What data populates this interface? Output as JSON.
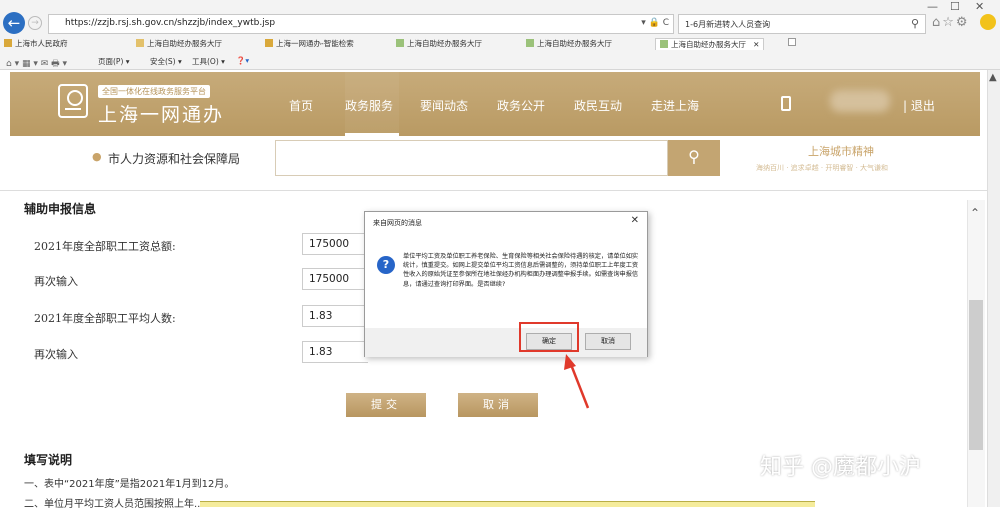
{
  "browser": {
    "url": "https://zzjb.rsj.sh.gov.cn/shzzjb/index_ywtb.jsp",
    "url_icons": "▾ 🔒 C",
    "search_query": "1-6月新进转入人员查询",
    "search_icon": "magnifier-icon",
    "window_controls": [
      "—",
      "☐",
      "✕"
    ],
    "favorites": [
      "上海市人民政府",
      "上海自助经办服务大厅",
      "上海一网通办-智能检索",
      "上海自助经办服务大厅",
      "上海自助经办服务大厅",
      "上海自助经办服务大厅"
    ],
    "active_tab_close": "✕",
    "commands": [
      "页面(P) ▾",
      "安全(S) ▾",
      "工具(O) ▾"
    ]
  },
  "site": {
    "badge": "全国一体化在线政务服务平台",
    "name": "上海一网通办",
    "nav": [
      "首页",
      "政务服务",
      "要闻动态",
      "政务公开",
      "政民互动",
      "走进上海"
    ],
    "logout": "退出",
    "department": "市人力资源和社会保障局",
    "search_button_icon": "search-icon",
    "motto": "上海城市精神",
    "motto_sub": "海纳百川 · 追求卓越 · 开明睿智 · 大气谦和"
  },
  "form": {
    "section_title": "辅助申报信息",
    "fields": [
      {
        "label": "2021年度全部职工工资总额:",
        "value": "175000"
      },
      {
        "label": "再次输入",
        "value": "175000"
      },
      {
        "label": "2021年度全部职工平均人数:",
        "value": "1.83"
      },
      {
        "label": "再次输入",
        "value": "1.83"
      }
    ],
    "submit_label": "提交",
    "cancel_label": "取消"
  },
  "notes": {
    "title": "填写说明",
    "lines": [
      "一、表中“2021年度”是指2021年1月到12月。",
      "二、单位月平均工资人员范围按照上年..."
    ]
  },
  "dialog": {
    "title": "来自网页的消息",
    "close": "✕",
    "icon": "question-icon",
    "message": "单位平均工资及单位职工养老保险、生育保险等相关社会保险待遇的核定，请单位如实统计，慎重提交。如网上提交单位平均工资信息后需调整的，须持单位职工上年度工资性收入的原始凭证至参保所在地社保经办机构柜面办理调整申报手续。如需查询申报信息，请通过查询打印界面。是否继续?",
    "ok_label": "确定",
    "cancel_label": "取消"
  },
  "watermark": "知乎 @魔都小沪",
  "colors": {
    "header_gold": "#c3a572",
    "accent_blue": "#2765c8",
    "highlight_red": "#e0392b"
  }
}
